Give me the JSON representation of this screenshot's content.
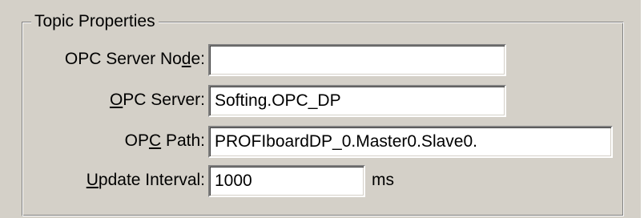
{
  "group": {
    "title": "Topic Properties"
  },
  "fields": {
    "server_node": {
      "label_pre": "OPC Server No",
      "label_key": "d",
      "label_post": "e:",
      "value": ""
    },
    "server": {
      "label_pre": "",
      "label_key": "O",
      "label_post": "PC Server:",
      "value": "Softing.OPC_DP"
    },
    "path": {
      "label_pre": "OP",
      "label_key": "C",
      "label_post": " Path:",
      "value": "PROFIboardDP_0.Master0.Slave0."
    },
    "interval": {
      "label_pre": "",
      "label_key": "U",
      "label_post": "pdate Interval:",
      "value": "1000",
      "unit": "ms"
    }
  }
}
